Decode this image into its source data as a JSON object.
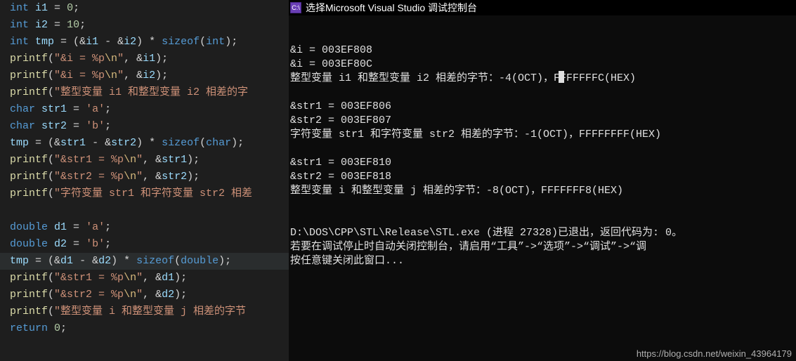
{
  "editor": {
    "lines": [
      [
        [
          "kw",
          "int"
        ],
        [
          "op",
          " "
        ],
        [
          "id",
          "i1"
        ],
        [
          "op",
          " = "
        ],
        [
          "nm",
          "0"
        ],
        [
          "pn",
          ";"
        ]
      ],
      [
        [
          "kw",
          "int"
        ],
        [
          "op",
          " "
        ],
        [
          "id",
          "i2"
        ],
        [
          "op",
          " = "
        ],
        [
          "nm",
          "10"
        ],
        [
          "pn",
          ";"
        ]
      ],
      [
        [
          "kw",
          "int"
        ],
        [
          "op",
          " "
        ],
        [
          "id",
          "tmp"
        ],
        [
          "op",
          " = ("
        ],
        [
          "op",
          "&"
        ],
        [
          "id",
          "i1"
        ],
        [
          "op",
          " - &"
        ],
        [
          "id",
          "i2"
        ],
        [
          "op",
          ") * "
        ],
        [
          "kw",
          "sizeof"
        ],
        [
          "pn",
          "("
        ],
        [
          "kw",
          "int"
        ],
        [
          "pn",
          ");"
        ]
      ],
      [
        [
          "fn",
          "printf"
        ],
        [
          "pn",
          "("
        ],
        [
          "st",
          "\"&i = %p"
        ],
        [
          "es",
          "\\n"
        ],
        [
          "st",
          "\""
        ],
        [
          "pn",
          ", &"
        ],
        [
          "id",
          "i1"
        ],
        [
          "pn",
          ");"
        ]
      ],
      [
        [
          "fn",
          "printf"
        ],
        [
          "pn",
          "("
        ],
        [
          "st",
          "\"&i = %p"
        ],
        [
          "es",
          "\\n"
        ],
        [
          "st",
          "\""
        ],
        [
          "pn",
          ", &"
        ],
        [
          "id",
          "i2"
        ],
        [
          "pn",
          ");"
        ]
      ],
      [
        [
          "fn",
          "printf"
        ],
        [
          "pn",
          "("
        ],
        [
          "st",
          "\"整型变量 i1 和整型变量 i2 相差的字"
        ]
      ],
      [
        [
          "kw",
          "char"
        ],
        [
          "op",
          " "
        ],
        [
          "id",
          "str1"
        ],
        [
          "op",
          " = "
        ],
        [
          "st",
          "'a'"
        ],
        [
          "pn",
          ";"
        ]
      ],
      [
        [
          "kw",
          "char"
        ],
        [
          "op",
          " "
        ],
        [
          "id",
          "str2"
        ],
        [
          "op",
          " = "
        ],
        [
          "st",
          "'b'"
        ],
        [
          "pn",
          ";"
        ]
      ],
      [
        [
          "id",
          "tmp"
        ],
        [
          "op",
          " = ("
        ],
        [
          "op",
          "&"
        ],
        [
          "id",
          "str1"
        ],
        [
          "op",
          " - &"
        ],
        [
          "id",
          "str2"
        ],
        [
          "op",
          ") * "
        ],
        [
          "kw",
          "sizeof"
        ],
        [
          "pn",
          "("
        ],
        [
          "kw",
          "char"
        ],
        [
          "pn",
          ");"
        ]
      ],
      [
        [
          "fn",
          "printf"
        ],
        [
          "pn",
          "("
        ],
        [
          "st",
          "\"&str1 = %p"
        ],
        [
          "es",
          "\\n"
        ],
        [
          "st",
          "\""
        ],
        [
          "pn",
          ", &"
        ],
        [
          "id",
          "str1"
        ],
        [
          "pn",
          ");"
        ]
      ],
      [
        [
          "fn",
          "printf"
        ],
        [
          "pn",
          "("
        ],
        [
          "st",
          "\"&str2 = %p"
        ],
        [
          "es",
          "\\n"
        ],
        [
          "st",
          "\""
        ],
        [
          "pn",
          ", &"
        ],
        [
          "id",
          "str2"
        ],
        [
          "pn",
          ");"
        ]
      ],
      [
        [
          "fn",
          "printf"
        ],
        [
          "pn",
          "("
        ],
        [
          "st",
          "\"字符变量 str1 和字符变量 str2 相差"
        ]
      ],
      [
        [
          "op",
          ""
        ]
      ],
      [
        [
          "kw",
          "double"
        ],
        [
          "op",
          " "
        ],
        [
          "id",
          "d1"
        ],
        [
          "op",
          " = "
        ],
        [
          "st",
          "'a'"
        ],
        [
          "pn",
          ";"
        ]
      ],
      [
        [
          "kw",
          "double"
        ],
        [
          "op",
          " "
        ],
        [
          "id",
          "d2"
        ],
        [
          "op",
          " = "
        ],
        [
          "st",
          "'b'"
        ],
        [
          "pn",
          ";"
        ]
      ],
      [
        [
          "id",
          "tmp"
        ],
        [
          "op",
          " = ("
        ],
        [
          "op",
          "&"
        ],
        [
          "id",
          "d1"
        ],
        [
          "op",
          " - &"
        ],
        [
          "id",
          "d2"
        ],
        [
          "op",
          ") * "
        ],
        [
          "kw",
          "sizeof"
        ],
        [
          "pn",
          "("
        ],
        [
          "kw",
          "double"
        ],
        [
          "pn",
          ");"
        ]
      ],
      [
        [
          "fn",
          "printf"
        ],
        [
          "pn",
          "("
        ],
        [
          "st",
          "\"&str1 = %p"
        ],
        [
          "es",
          "\\n"
        ],
        [
          "st",
          "\""
        ],
        [
          "pn",
          ", &"
        ],
        [
          "id",
          "d1"
        ],
        [
          "pn",
          ");"
        ]
      ],
      [
        [
          "fn",
          "printf"
        ],
        [
          "pn",
          "("
        ],
        [
          "st",
          "\"&str2 = %p"
        ],
        [
          "es",
          "\\n"
        ],
        [
          "st",
          "\""
        ],
        [
          "pn",
          ", &"
        ],
        [
          "id",
          "d2"
        ],
        [
          "pn",
          ");"
        ]
      ],
      [
        [
          "fn",
          "printf"
        ],
        [
          "pn",
          "("
        ],
        [
          "st",
          "\"整型变量 i 和整型变量 j 相差的字节"
        ]
      ],
      [
        [
          "kw",
          "return"
        ],
        [
          "op",
          " "
        ],
        [
          "nm",
          "0"
        ],
        [
          "pn",
          ";"
        ]
      ]
    ],
    "highlight_index": 15
  },
  "console": {
    "title": "选择Microsoft Visual Studio 调试控制台",
    "lines": [
      "&i = 003EF808",
      "&i = 003EF80C",
      "整型变量 i1 和整型变量 i2 相差的字节：-4(OCT)，FFFFFFFC(HEX)",
      "",
      "&str1 = 003EF806",
      "&str2 = 003EF807",
      "字符变量 str1 和字符变量 str2 相差的字节：-1(OCT)，FFFFFFFF(HEX)",
      "",
      "&str1 = 003EF810",
      "&str2 = 003EF818",
      "整型变量 i 和整型变量 j 相差的字节：-8(OCT)，FFFFFFF8(HEX)",
      "",
      "",
      "D:\\DOS\\CPP\\STL\\Release\\STL.exe (进程 27328)已退出，返回代码为: 0。",
      "若要在调试停止时自动关闭控制台，请启用“工具”->“选项”->“调试”->“调",
      "按任意键关闭此窗口..."
    ]
  },
  "watermark": "https://blog.csdn.net/weixin_43964179"
}
